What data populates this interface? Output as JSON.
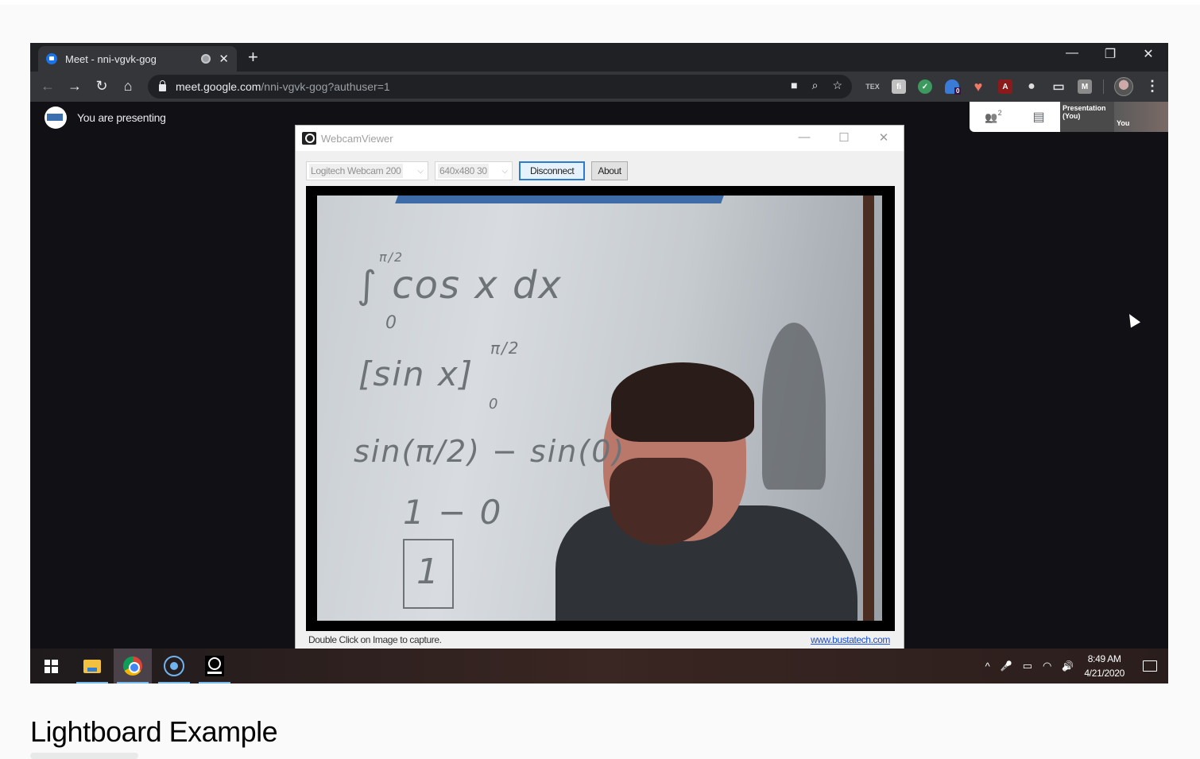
{
  "browser": {
    "tab_title": "Meet - nni-vgvk-gog",
    "tab_close": "✕",
    "new_tab": "+",
    "window_controls": {
      "minimize": "—",
      "restore": "❐",
      "close": "✕"
    },
    "nav": {
      "back": "←",
      "forward": "→",
      "reload": "↻",
      "home": "⌂"
    },
    "url_host": "meet.google.com",
    "url_path": "/nni-vgvk-gog?authuser=1",
    "omnibox_icons": {
      "camera": "■",
      "zoom": "⌕",
      "bookmark": "☆"
    },
    "extensions": [
      {
        "name": "tex",
        "label": "TEX",
        "color": "#35363a"
      },
      {
        "name": "figure",
        "label": "fi",
        "color": "#c0c0c0"
      },
      {
        "name": "grammar",
        "label": "✓",
        "color": "#3c9a5f"
      },
      {
        "name": "ghost",
        "label": "0",
        "color": "#3b7bd8"
      },
      {
        "name": "heart",
        "label": "♥",
        "color": "#35363a"
      },
      {
        "name": "acrobat",
        "label": "A",
        "color": "#8b1a1a"
      },
      {
        "name": "record",
        "label": "●",
        "color": "#35363a"
      },
      {
        "name": "screen",
        "label": "▭",
        "color": "#35363a"
      },
      {
        "name": "m",
        "label": "M",
        "color": "#8a8a8a"
      }
    ],
    "ghost_badge": "0",
    "menu": "⋮"
  },
  "meet": {
    "presenting_text": "You are presenting",
    "participants_count": "2",
    "participants_icon": "👥",
    "chat_icon": "▤",
    "thumb_presentation": "Presentation (You)",
    "thumb_you": "You"
  },
  "webcam_viewer": {
    "title": "WebcamViewer",
    "controls": {
      "minimize": "—",
      "maximize": "☐",
      "close": "✕"
    },
    "device": "Logitech Webcam 200",
    "resolution": "640x480 30",
    "dropdown_arrow": "⌵",
    "disconnect_label": "Disconnect",
    "about_label": "About",
    "status_text": "Double Click on Image to capture.",
    "link_text": "www.bustatech.com",
    "whiteboard": {
      "line1": "∫ cos x dx",
      "upper_limit": "π/2",
      "lower_limit": "0",
      "line2": "[sin x]",
      "line3": "sin(π/2) − sin(0)",
      "line4": "1 − 0",
      "line5": "1"
    }
  },
  "taskbar": {
    "tray_chevron": "^",
    "mic_icon": "🎤",
    "battery_icon": "▭",
    "wifi_icon": "◠",
    "volume_icon": "🔊",
    "time": "8:49 AM",
    "date": "4/21/2020"
  },
  "caption": {
    "title": "Lightboard Example"
  }
}
